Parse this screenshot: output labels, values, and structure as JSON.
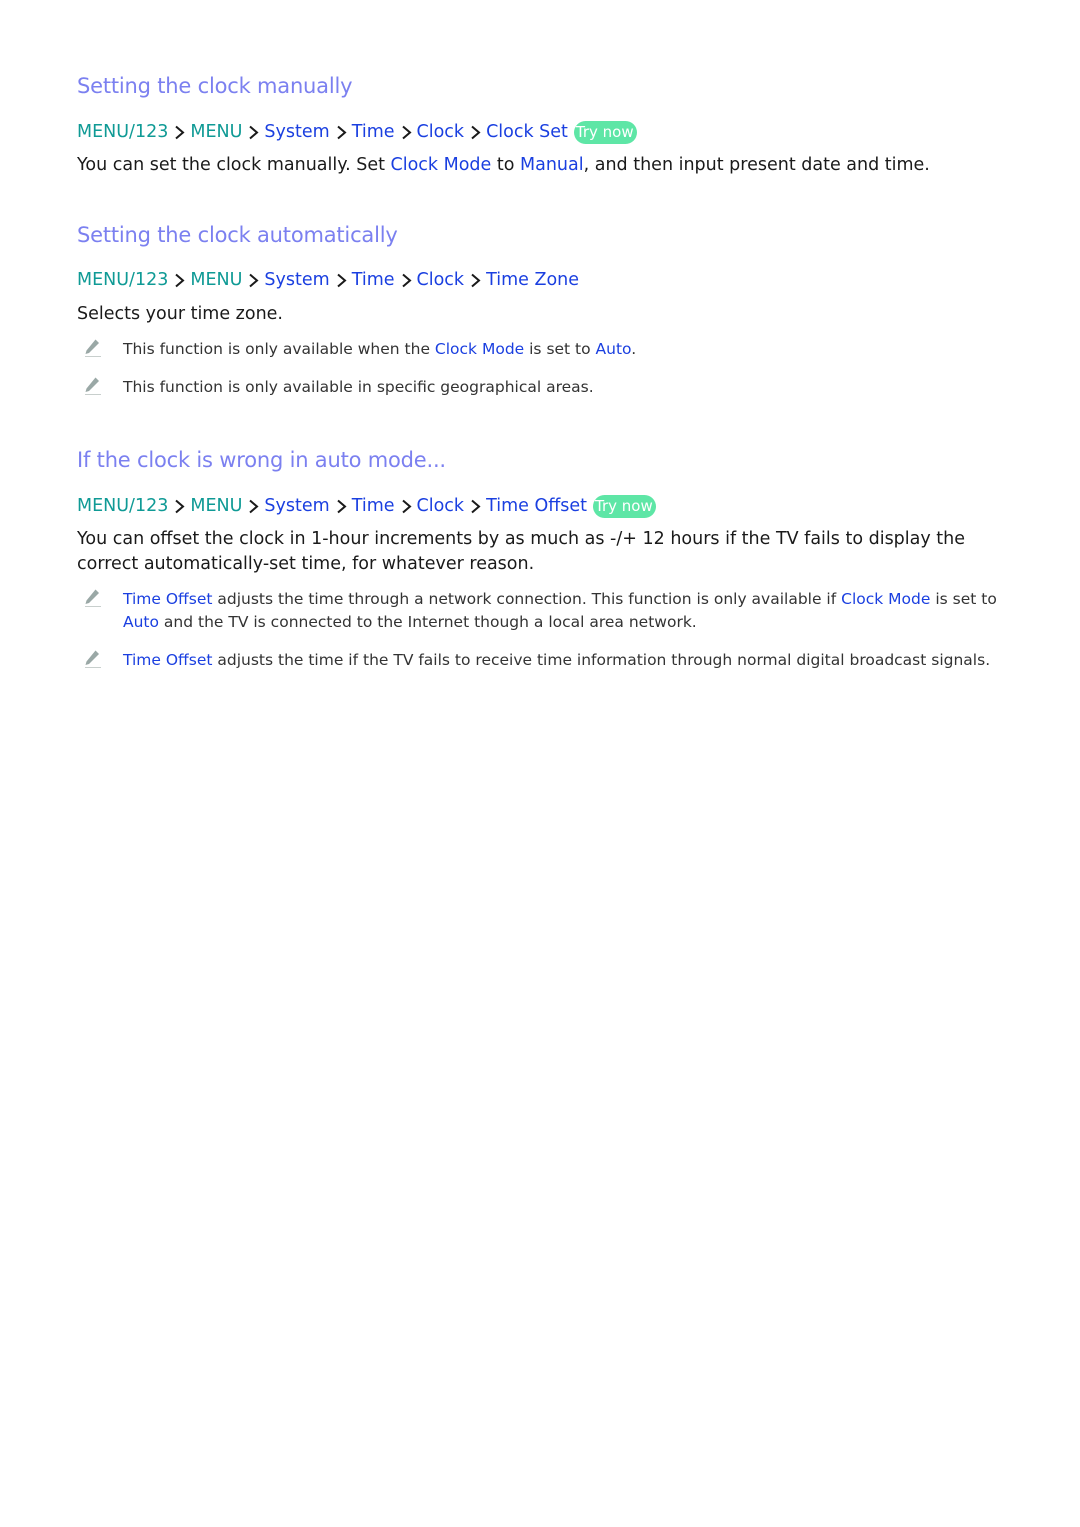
{
  "sections": [
    {
      "title": "Setting the clock manually",
      "path": {
        "items": [
          {
            "label": "MENU/123",
            "style": "teal"
          },
          {
            "label": "MENU",
            "style": "teal"
          },
          {
            "label": "System",
            "style": "blue"
          },
          {
            "label": "Time",
            "style": "blue"
          },
          {
            "label": "Clock",
            "style": "blue"
          },
          {
            "label": "Clock Set",
            "style": "blue"
          }
        ],
        "try_now": "Try now"
      },
      "body": {
        "t1": "You can set the clock manually. Set ",
        "l1": "Clock Mode",
        "t2": " to ",
        "l2": "Manual",
        "t3": ", and then input present date and time."
      }
    },
    {
      "title": "Setting the clock automatically",
      "path": {
        "items": [
          {
            "label": "MENU/123",
            "style": "teal"
          },
          {
            "label": "MENU",
            "style": "teal"
          },
          {
            "label": "System",
            "style": "blue"
          },
          {
            "label": "Time",
            "style": "blue"
          },
          {
            "label": "Clock",
            "style": "blue"
          },
          {
            "label": "Time Zone",
            "style": "blue"
          }
        ]
      },
      "body": "Selects your time zone.",
      "notes": [
        {
          "t1": "This function is only available when the ",
          "l1": "Clock Mode",
          "t2": " is set to ",
          "l2": "Auto",
          "t3": "."
        },
        {
          "t1": "This function is only available in specific geographical areas."
        }
      ]
    },
    {
      "title": "If the clock is wrong in auto mode...",
      "path": {
        "items": [
          {
            "label": "MENU/123",
            "style": "teal"
          },
          {
            "label": "MENU",
            "style": "teal"
          },
          {
            "label": "System",
            "style": "blue"
          },
          {
            "label": "Time",
            "style": "blue"
          },
          {
            "label": "Clock",
            "style": "blue"
          },
          {
            "label": "Time Offset",
            "style": "blue"
          }
        ],
        "try_now": "Try now"
      },
      "body": "You can offset the clock in 1-hour increments by as much as -/+ 12 hours if the TV fails to display the correct automatically-set time, for whatever reason.",
      "notes": [
        {
          "l1": "Time Offset",
          "t1": " adjusts the time through a network connection. This function is only available if ",
          "l2": "Clock Mode",
          "t2": " is set to ",
          "l3": "Auto",
          "t3": " and the TV is connected to the Internet though a local area network."
        },
        {
          "l1": "Time Offset",
          "t1": " adjusts the time if the TV fails to receive time information through normal digital broadcast signals."
        }
      ]
    }
  ],
  "icons": {
    "separator": "chevron-right-icon",
    "note": "pencil-icon"
  },
  "colors": {
    "heading": "#7b80f0",
    "path_teal": "#0f9a95",
    "link_blue": "#1a3fe0",
    "try_now_bg": "#5ee6a6",
    "text": "#1a1a1a"
  }
}
